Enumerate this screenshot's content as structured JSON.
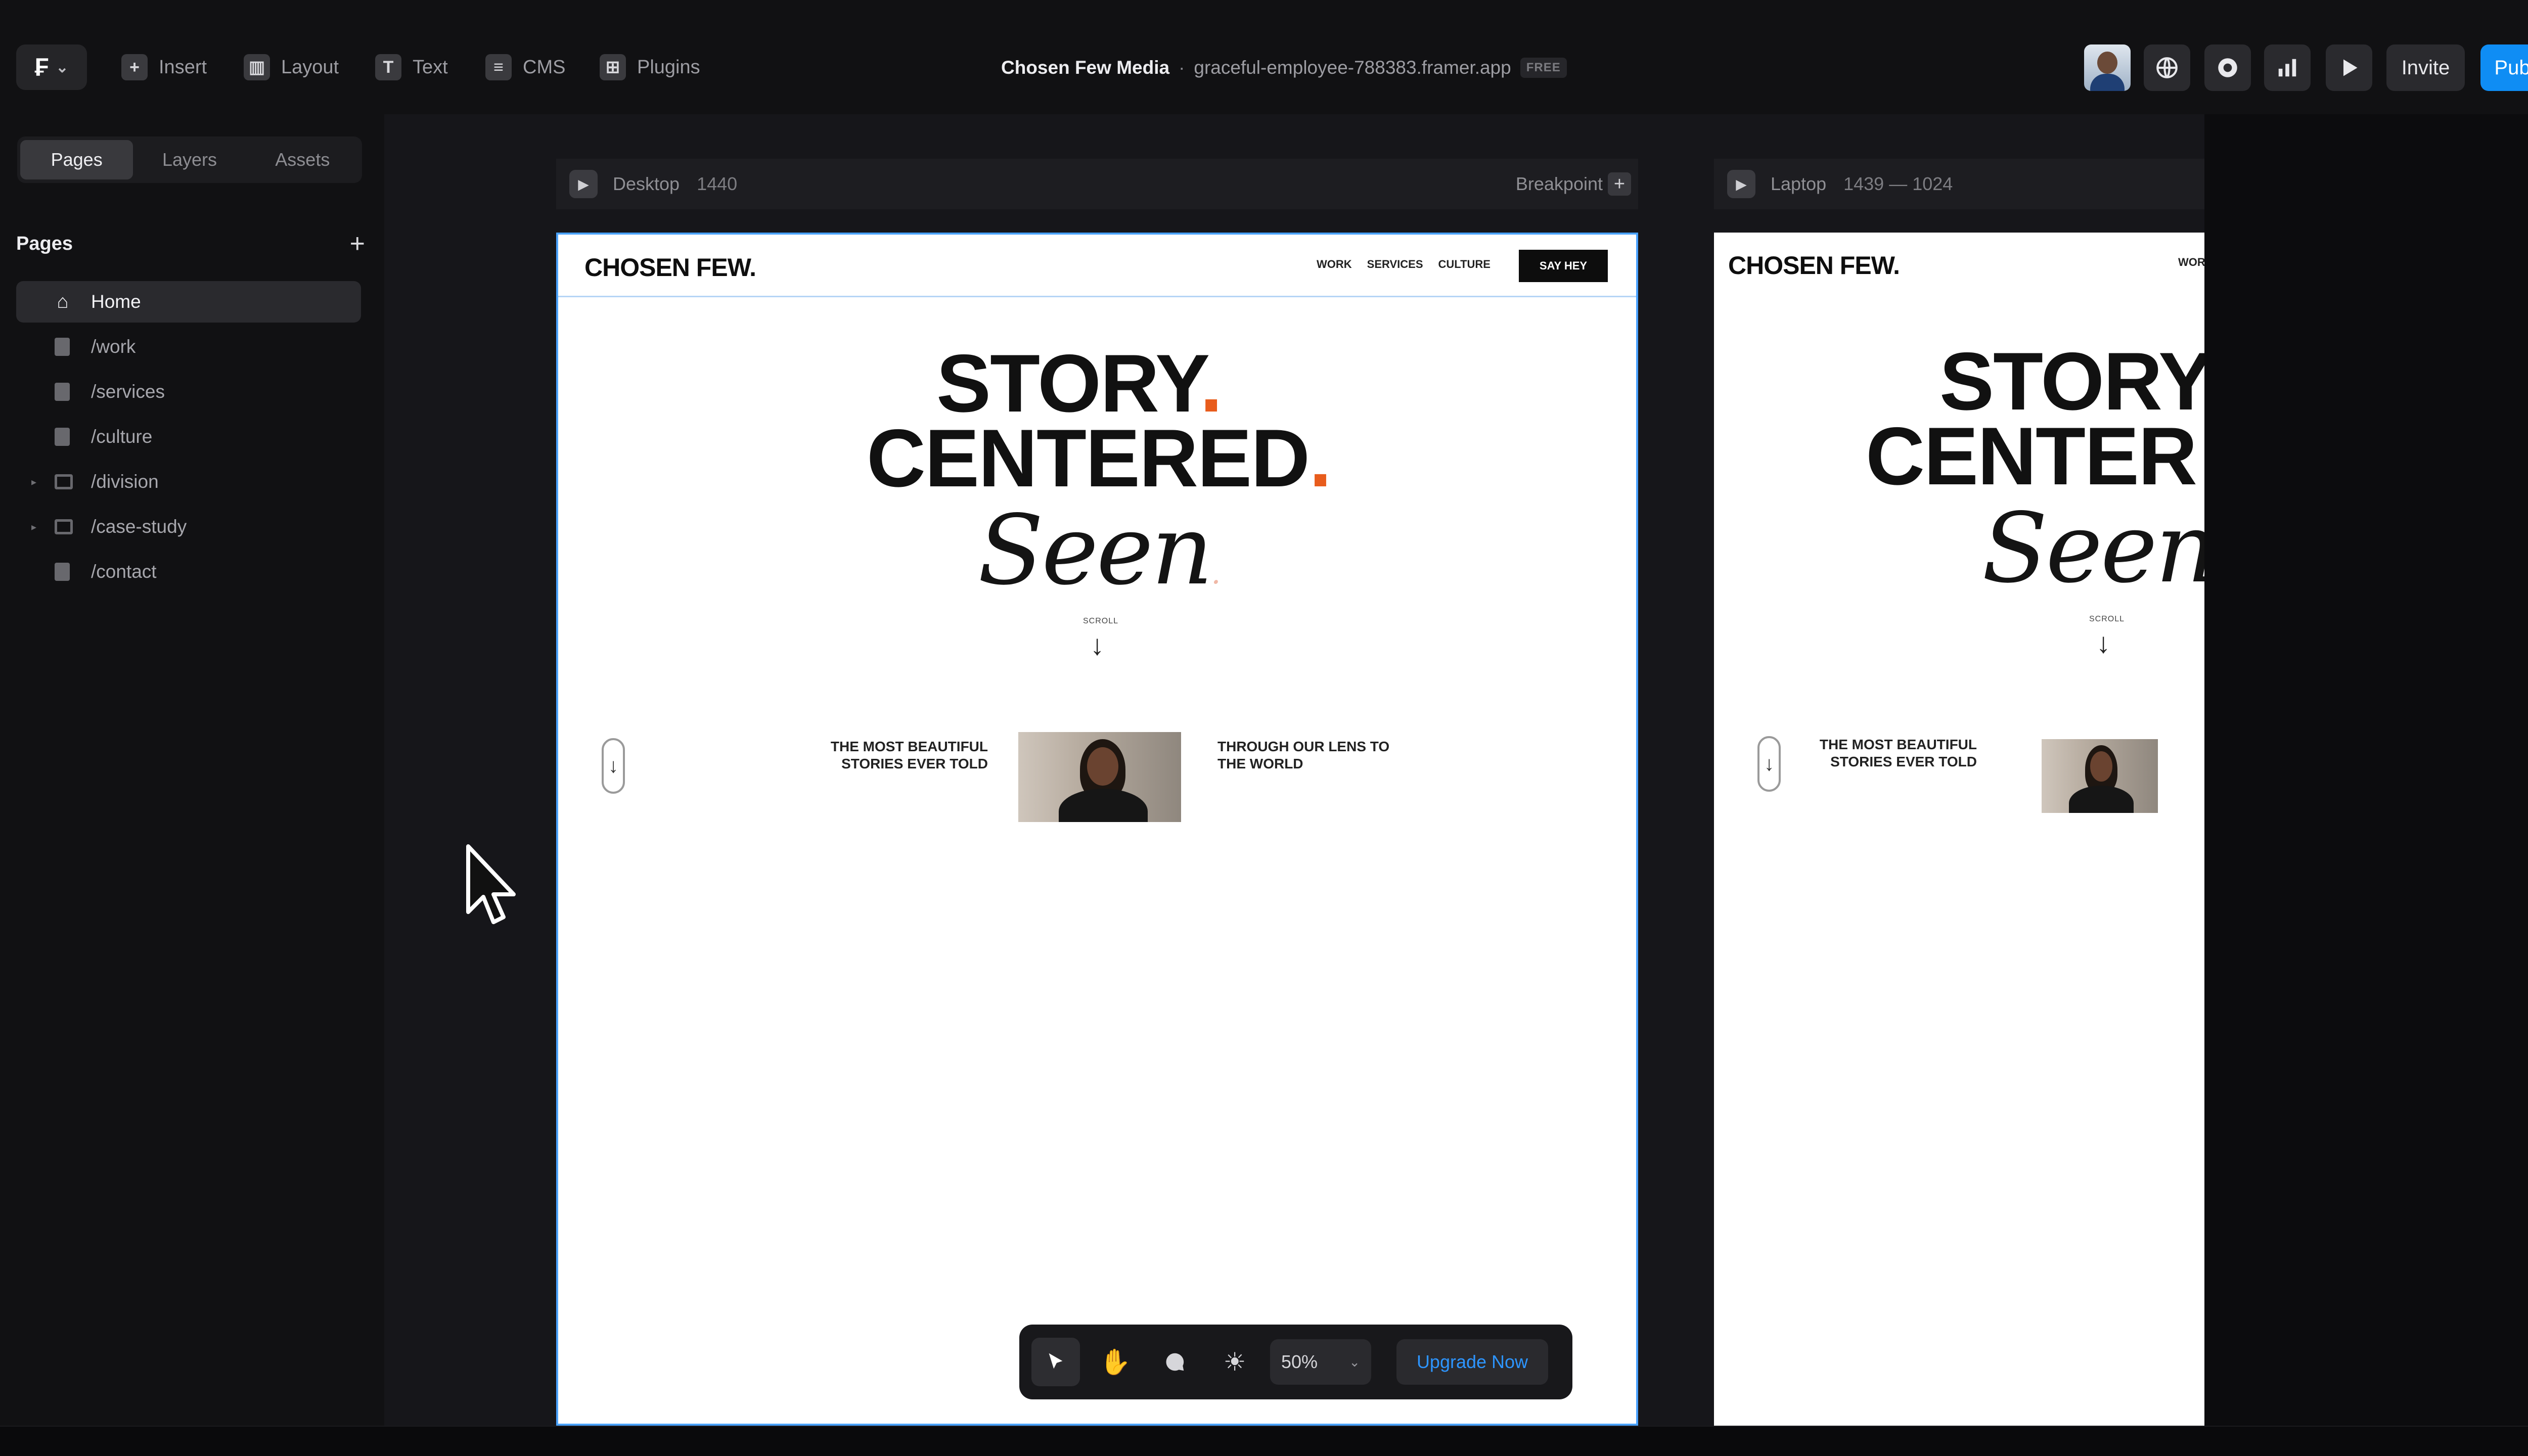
{
  "topbar": {
    "logo_glyph": "₣",
    "logo_chevron": "⌄",
    "tools": [
      {
        "label": "Insert",
        "icon": "plus-square-icon"
      },
      {
        "label": "Layout",
        "icon": "layout-icon"
      },
      {
        "label": "Text",
        "icon": "text-icon"
      },
      {
        "label": "CMS",
        "icon": "database-icon"
      },
      {
        "label": "Plugins",
        "icon": "grid-icon"
      }
    ],
    "project_name": "Chosen Few Media",
    "separator": "·",
    "project_url": "graceful-employee-788383.framer.app",
    "plan_badge": "FREE",
    "invite_label": "Invite",
    "publish_label": "Publish",
    "publish_color": "#0f8df4"
  },
  "sidebar": {
    "tabs": [
      "Pages",
      "Layers",
      "Assets"
    ],
    "active_tab": "Pages",
    "section_title": "Pages",
    "add_glyph": "+",
    "pages": [
      {
        "name": "Home",
        "type": "home",
        "active": true
      },
      {
        "name": "/work",
        "type": "page"
      },
      {
        "name": "/services",
        "type": "page"
      },
      {
        "name": "/culture",
        "type": "page"
      },
      {
        "name": "/division",
        "type": "folder"
      },
      {
        "name": "/case-study",
        "type": "folder"
      },
      {
        "name": "/contact",
        "type": "page"
      }
    ]
  },
  "canvas": {
    "desktop": {
      "label": "Desktop",
      "size": "1440",
      "breakpoint_label": "Breakpoint",
      "breakpoint_plus": "+"
    },
    "laptop": {
      "label": "Laptop",
      "size": "1439 — 1024"
    },
    "site": {
      "brand": "CHOSEN FEW.",
      "nav": [
        "WORK",
        "SERVICES",
        "CULTURE"
      ],
      "cta": "SAY HEY",
      "hero_line1": "STORY",
      "hero_line2": "CENTERED",
      "hero_dot": ".",
      "hero_script": "Seen",
      "scroll_label": "SCROLL",
      "scroll_arrow": "↓",
      "tagline_left": "THE MOST BEAUTIFUL STORIES EVER TOLD",
      "tagline_right": "THROUGH OUR LENS TO THE WORLD",
      "accent_color": "#e85c1c"
    },
    "laptop_preview": {
      "brand": "CHOSEN FEW.",
      "nav_partial": "WOR",
      "hero_line1": "STORY",
      "hero_line2": "CENTER",
      "hero_script": "Seen",
      "scroll_label": "SCROLL",
      "tagline_left": "THE MOST BEAUTIFUL STORIES EVER TOLD"
    }
  },
  "floating_toolbar": {
    "zoom": "50%",
    "zoom_chevron": "⌄",
    "upgrade_label": "Upgrade Now",
    "upgrade_color": "#2d95ff"
  }
}
